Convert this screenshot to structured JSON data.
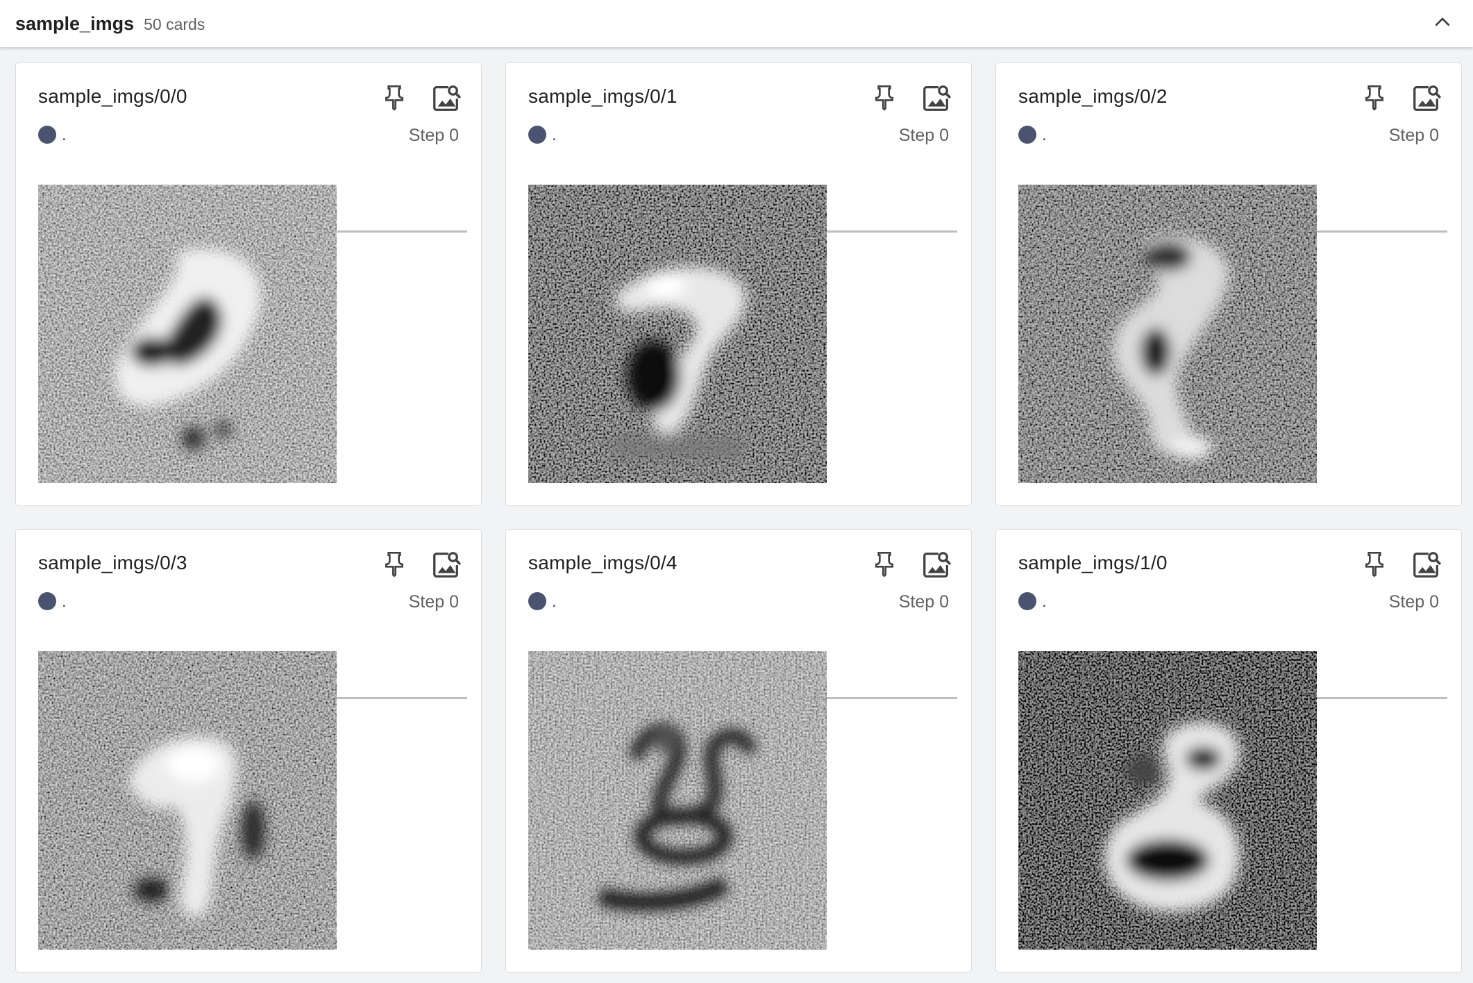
{
  "header": {
    "title": "sample_imgs",
    "count": "50 cards"
  },
  "icons": {
    "collapse": "chevron-up-icon",
    "pin": "pin-icon",
    "view": "image-search-icon"
  },
  "colors": {
    "run_dot": "#4a5370",
    "background": "#f1f3f4"
  },
  "cards": [
    {
      "title": "sample_imgs/0/0",
      "run": ".",
      "step": "Step 0",
      "image": "noisy grayscale sample image"
    },
    {
      "title": "sample_imgs/0/1",
      "run": ".",
      "step": "Step 0",
      "image": "noisy grayscale sample image"
    },
    {
      "title": "sample_imgs/0/2",
      "run": ".",
      "step": "Step 0",
      "image": "noisy grayscale sample image"
    },
    {
      "title": "sample_imgs/0/3",
      "run": ".",
      "step": "Step 0",
      "image": "noisy grayscale sample image"
    },
    {
      "title": "sample_imgs/0/4",
      "run": ".",
      "step": "Step 0",
      "image": "noisy grayscale sample image"
    },
    {
      "title": "sample_imgs/1/0",
      "run": ".",
      "step": "Step 0",
      "image": "noisy grayscale sample image"
    }
  ]
}
